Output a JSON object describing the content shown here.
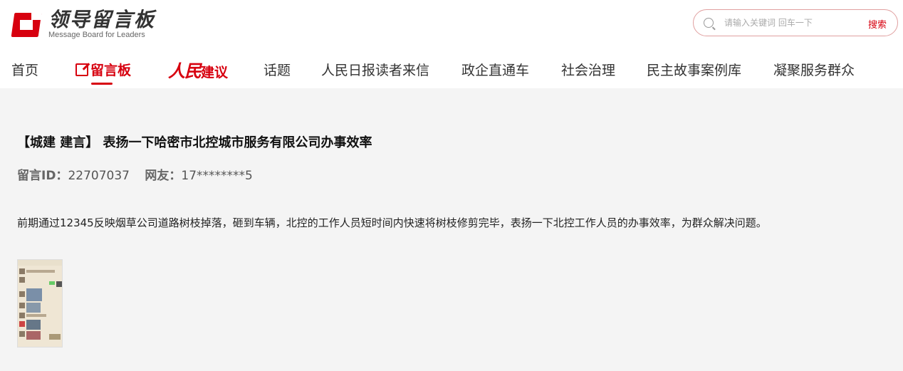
{
  "header": {
    "logo_title": "领导留言板",
    "logo_subtitle": "Message Board for Leaders"
  },
  "search": {
    "placeholder": "请输入关键词 回车一下",
    "button_label": "搜索"
  },
  "nav": {
    "items": [
      {
        "label": "首页"
      },
      {
        "label": "留言板"
      },
      {
        "label": "人民建议",
        "brand_prefix": "人民",
        "suffix": "建议"
      },
      {
        "label": "话题"
      },
      {
        "label": "人民日报读者来信"
      },
      {
        "label": "政企直通车"
      },
      {
        "label": "社会治理"
      },
      {
        "label": "民主故事案例库"
      },
      {
        "label": "凝聚服务群众"
      }
    ],
    "active_index": 1
  },
  "message": {
    "title": "【城建 建言】 表扬一下哈密市北控城市服务有限公司办事效率",
    "id_label": "留言ID：",
    "id_value": "22707037",
    "user_label": "网友：",
    "user_value": "17********5",
    "body": "前期通过12345反映烟草公司道路树枝掉落，砸到车辆，北控的工作人员短时间内快速将树枝修剪完毕，表扬一下北控工作人员的办事效率，为群众解决问题。"
  },
  "colors": {
    "accent": "#d7000f",
    "background": "#f4f4f4"
  }
}
